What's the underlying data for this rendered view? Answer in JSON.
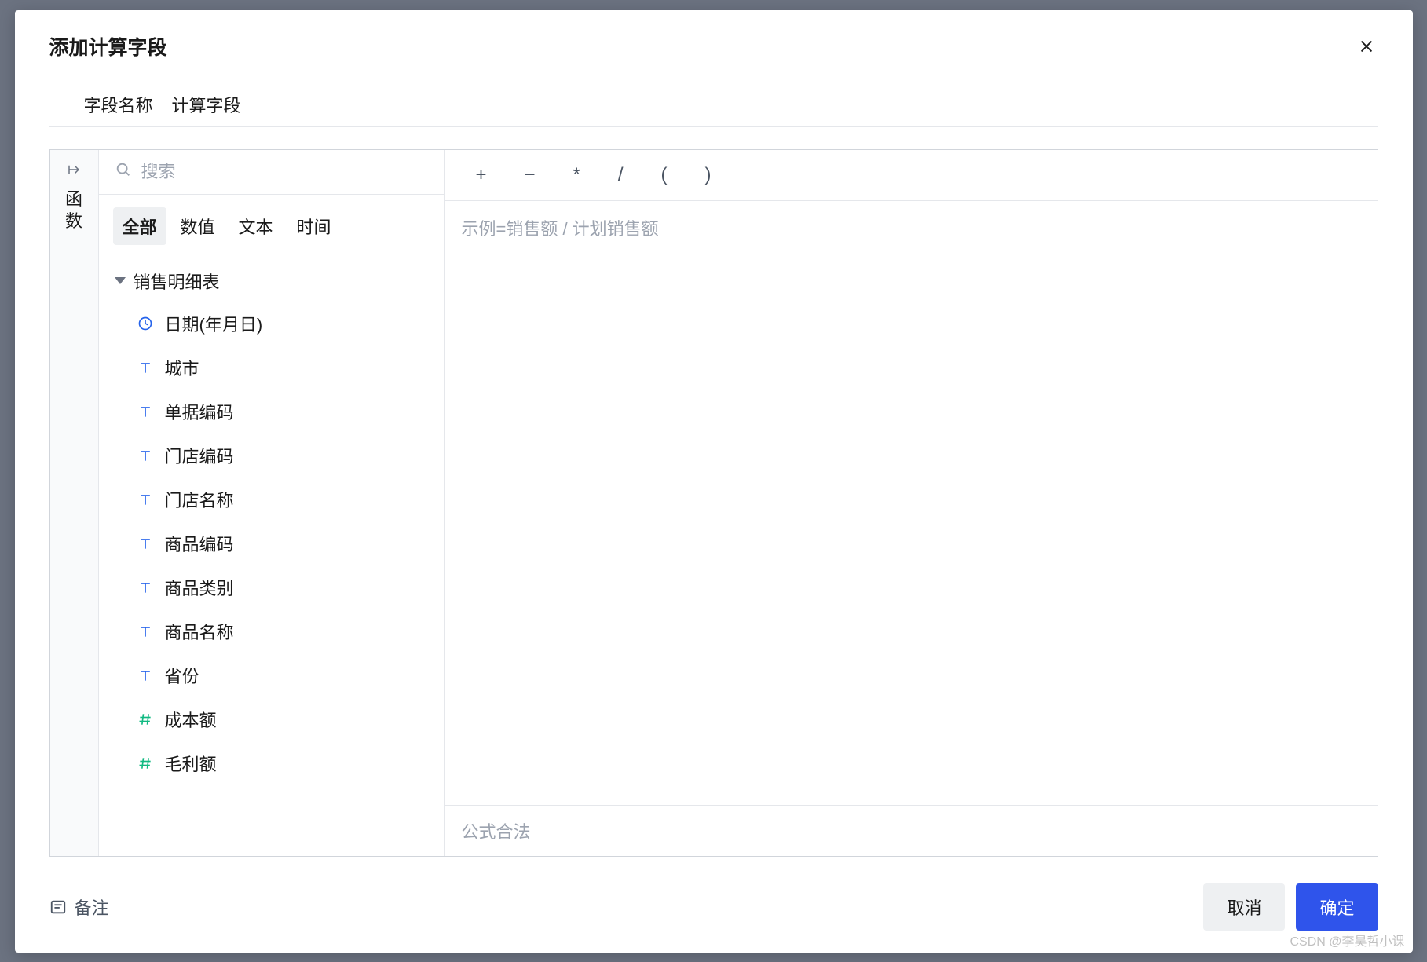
{
  "modal": {
    "title": "添加计算字段"
  },
  "fieldName": {
    "label": "字段名称",
    "value": "计算字段"
  },
  "sidebar": {
    "funcLabel": "函数"
  },
  "search": {
    "placeholder": "搜索"
  },
  "filterTabs": {
    "all": "全部",
    "number": "数值",
    "text": "文本",
    "time": "时间"
  },
  "tree": {
    "groupName": "销售明细表",
    "fields": [
      {
        "type": "clock",
        "label": "日期(年月日)"
      },
      {
        "type": "text",
        "label": "城市"
      },
      {
        "type": "text",
        "label": "单据编码"
      },
      {
        "type": "text",
        "label": "门店编码"
      },
      {
        "type": "text",
        "label": "门店名称"
      },
      {
        "type": "text",
        "label": "商品编码"
      },
      {
        "type": "text",
        "label": "商品类别"
      },
      {
        "type": "text",
        "label": "商品名称"
      },
      {
        "type": "text",
        "label": "省份"
      },
      {
        "type": "num",
        "label": "成本额"
      },
      {
        "type": "num",
        "label": "毛利额"
      }
    ]
  },
  "operators": {
    "plus": "+",
    "minus": "−",
    "mult": "*",
    "div": "/",
    "lp": "(",
    "rp": ")"
  },
  "formula": {
    "placeholder": "示例=销售额 / 计划销售额",
    "status": "公式合法"
  },
  "footer": {
    "remark": "备注",
    "cancel": "取消",
    "ok": "确定"
  },
  "watermark": "CSDN @李昊哲小课"
}
